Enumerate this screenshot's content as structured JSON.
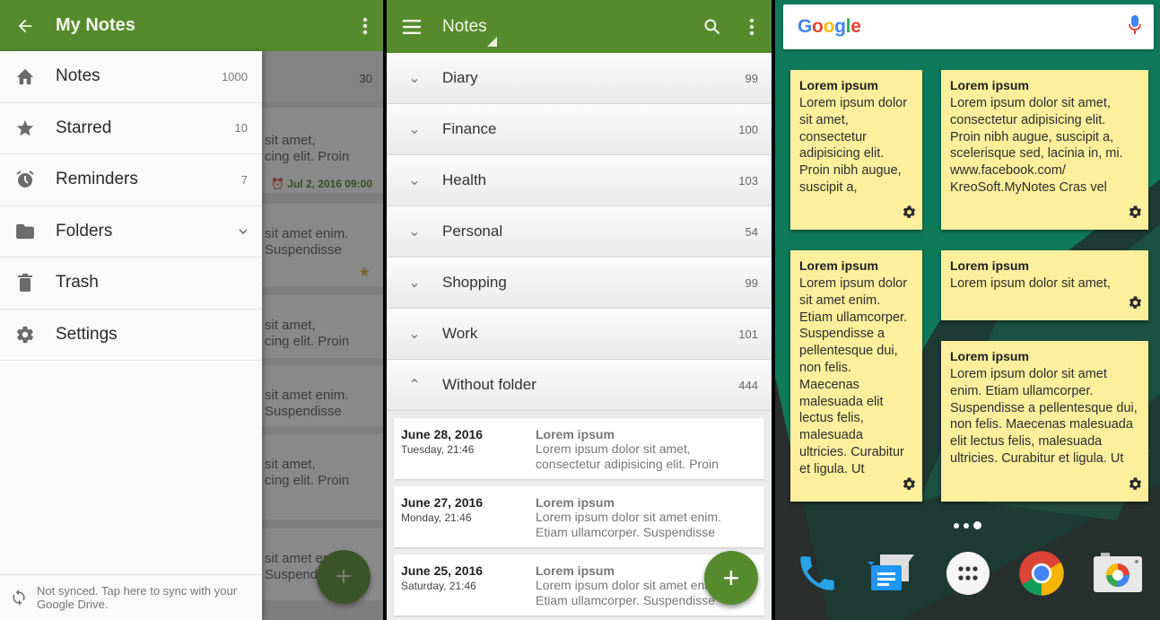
{
  "drawer_screen": {
    "app_title": "My Notes",
    "items": [
      {
        "label": "Notes",
        "count": "1000",
        "icon": "home-icon"
      },
      {
        "label": "Starred",
        "count": "10",
        "icon": "star-icon"
      },
      {
        "label": "Reminders",
        "count": "7",
        "icon": "alarm-icon"
      },
      {
        "label": "Folders",
        "count": "",
        "icon": "folder-icon"
      },
      {
        "label": "Trash",
        "count": "",
        "icon": "trash-icon"
      },
      {
        "label": "Settings",
        "count": "",
        "icon": "gear-icon"
      }
    ],
    "sync_text": "Not synced. Tap here to sync with your Google Drive.",
    "background": {
      "header_count": "30",
      "rows": [
        {
          "line1": "sit amet,",
          "line2": "cing elit. Proin",
          "reminder": "Jul 2, 2016 09:00"
        },
        {
          "line1": "sit amet enim.",
          "line2": "Suspendisse",
          "starred": true
        },
        {
          "line1": "sit amet,",
          "line2": "cing elit. Proin"
        },
        {
          "line1": "sit amet enim.",
          "line2": "Suspendisse"
        },
        {
          "line1": "sit amet,",
          "line2": "cing elit. Proin"
        },
        {
          "line1": "sit amet enim.",
          "line2": "Suspendisse"
        }
      ],
      "fab_label": "+"
    }
  },
  "folders_screen": {
    "title": "Notes",
    "folders": [
      {
        "name": "Diary",
        "count": "99",
        "expanded": false
      },
      {
        "name": "Finance",
        "count": "100",
        "expanded": false
      },
      {
        "name": "Health",
        "count": "103",
        "expanded": false
      },
      {
        "name": "Personal",
        "count": "54",
        "expanded": false
      },
      {
        "name": "Shopping",
        "count": "99",
        "expanded": false
      },
      {
        "name": "Work",
        "count": "101",
        "expanded": false
      },
      {
        "name": "Without folder",
        "count": "444",
        "expanded": true
      }
    ],
    "notes": [
      {
        "date": "June 28, 2016",
        "weekday_time": "Tuesday, 21:46",
        "title": "Lorem ipsum",
        "line1": "Lorem ipsum dolor sit amet,",
        "line2": "consectetur adipisicing elit. Proin"
      },
      {
        "date": "June 27, 2016",
        "weekday_time": "Monday, 21:46",
        "title": "Lorem ipsum",
        "line1": "Lorem ipsum dolor sit amet enim.",
        "line2": "Etiam ullamcorper. Suspendisse"
      },
      {
        "date": "June 25, 2016",
        "weekday_time": "Saturday, 21:46",
        "title": "Lorem ipsum",
        "line1": "Lorem ipsum dolor sit amet enim.",
        "line2": "Etiam ullamcorper. Suspendisse"
      }
    ],
    "fab_label": "+"
  },
  "home_screen": {
    "search_logo": [
      "G",
      "o",
      "o",
      "g",
      "l",
      "e"
    ],
    "logo_colors": [
      "#4285f4",
      "#ea4335",
      "#fbbc05",
      "#4285f4",
      "#34a853",
      "#ea4335"
    ],
    "widgets": [
      {
        "title": "Lorem ipsum",
        "body": "Lorem ipsum dolor sit amet, consectetur adipisicing elit. Proin nibh augue, suscipit a, scelerisque sed"
      },
      {
        "title": "Lorem ipsum",
        "body": "Lorem ipsum dolor sit amet, consectetur adipisicing elit. Proin nibh augue, suscipit a, scelerisque sed, lacinia in, mi. www.facebook.com/ KreoSoft.MyNotes Cras vel lorem. Etiam"
      },
      {
        "title": "Lorem ipsum",
        "body": "Lorem ipsum dolor sit amet enim. Etiam ullamcorper. Suspendisse a pellentesque dui, non felis. Maecenas malesuada elit lectus felis, malesuada ultricies. Curabitur et ligula. Ut"
      },
      {
        "title": "Lorem ipsum",
        "body": "Lorem ipsum dolor sit amet,"
      },
      {
        "title": "Lorem ipsum",
        "body": "Lorem ipsum dolor sit amet enim. Etiam ullamcorper. Suspendisse a pellentesque dui, non felis. Maecenas malesuada elit lectus felis, malesuada ultricies. Curabitur et ligula. Ut molestie a, ultricies porta"
      }
    ],
    "page_indicator": {
      "pages": 3,
      "current": 3
    },
    "dock": [
      "phone-icon",
      "messages-icon",
      "app-drawer-icon",
      "chrome-icon",
      "camera-icon"
    ]
  },
  "colors": {
    "primary": "#568b2d",
    "widget_yellow": "#fdef9c",
    "wallpaper_teal": "#0f7a5a",
    "wallpaper_dark": "#25302e"
  }
}
